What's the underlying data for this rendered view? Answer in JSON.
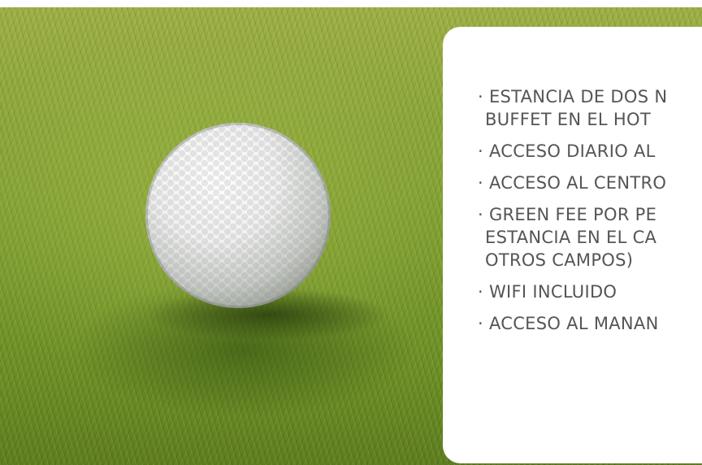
{
  "image": {
    "subject": "golf-ball-icon"
  },
  "amenities": {
    "items": [
      {
        "lines": [
          "· ESTANCIA DE DOS N",
          "BUFFET EN EL HOT"
        ]
      },
      {
        "lines": [
          "· ACCESO DIARIO AL"
        ]
      },
      {
        "lines": [
          "· ACCESO AL CENTRO"
        ]
      },
      {
        "lines": [
          "· GREEN FEE POR PE",
          "ESTANCIA EN EL CA",
          "OTROS CAMPOS)"
        ]
      },
      {
        "lines": [
          "· WIFI INCLUIDO"
        ]
      },
      {
        "lines": [
          "· ACCESO AL MANAN"
        ]
      }
    ]
  },
  "colors": {
    "text": "#555555",
    "card": "#ffffff",
    "grass": "#7b9c2e"
  }
}
